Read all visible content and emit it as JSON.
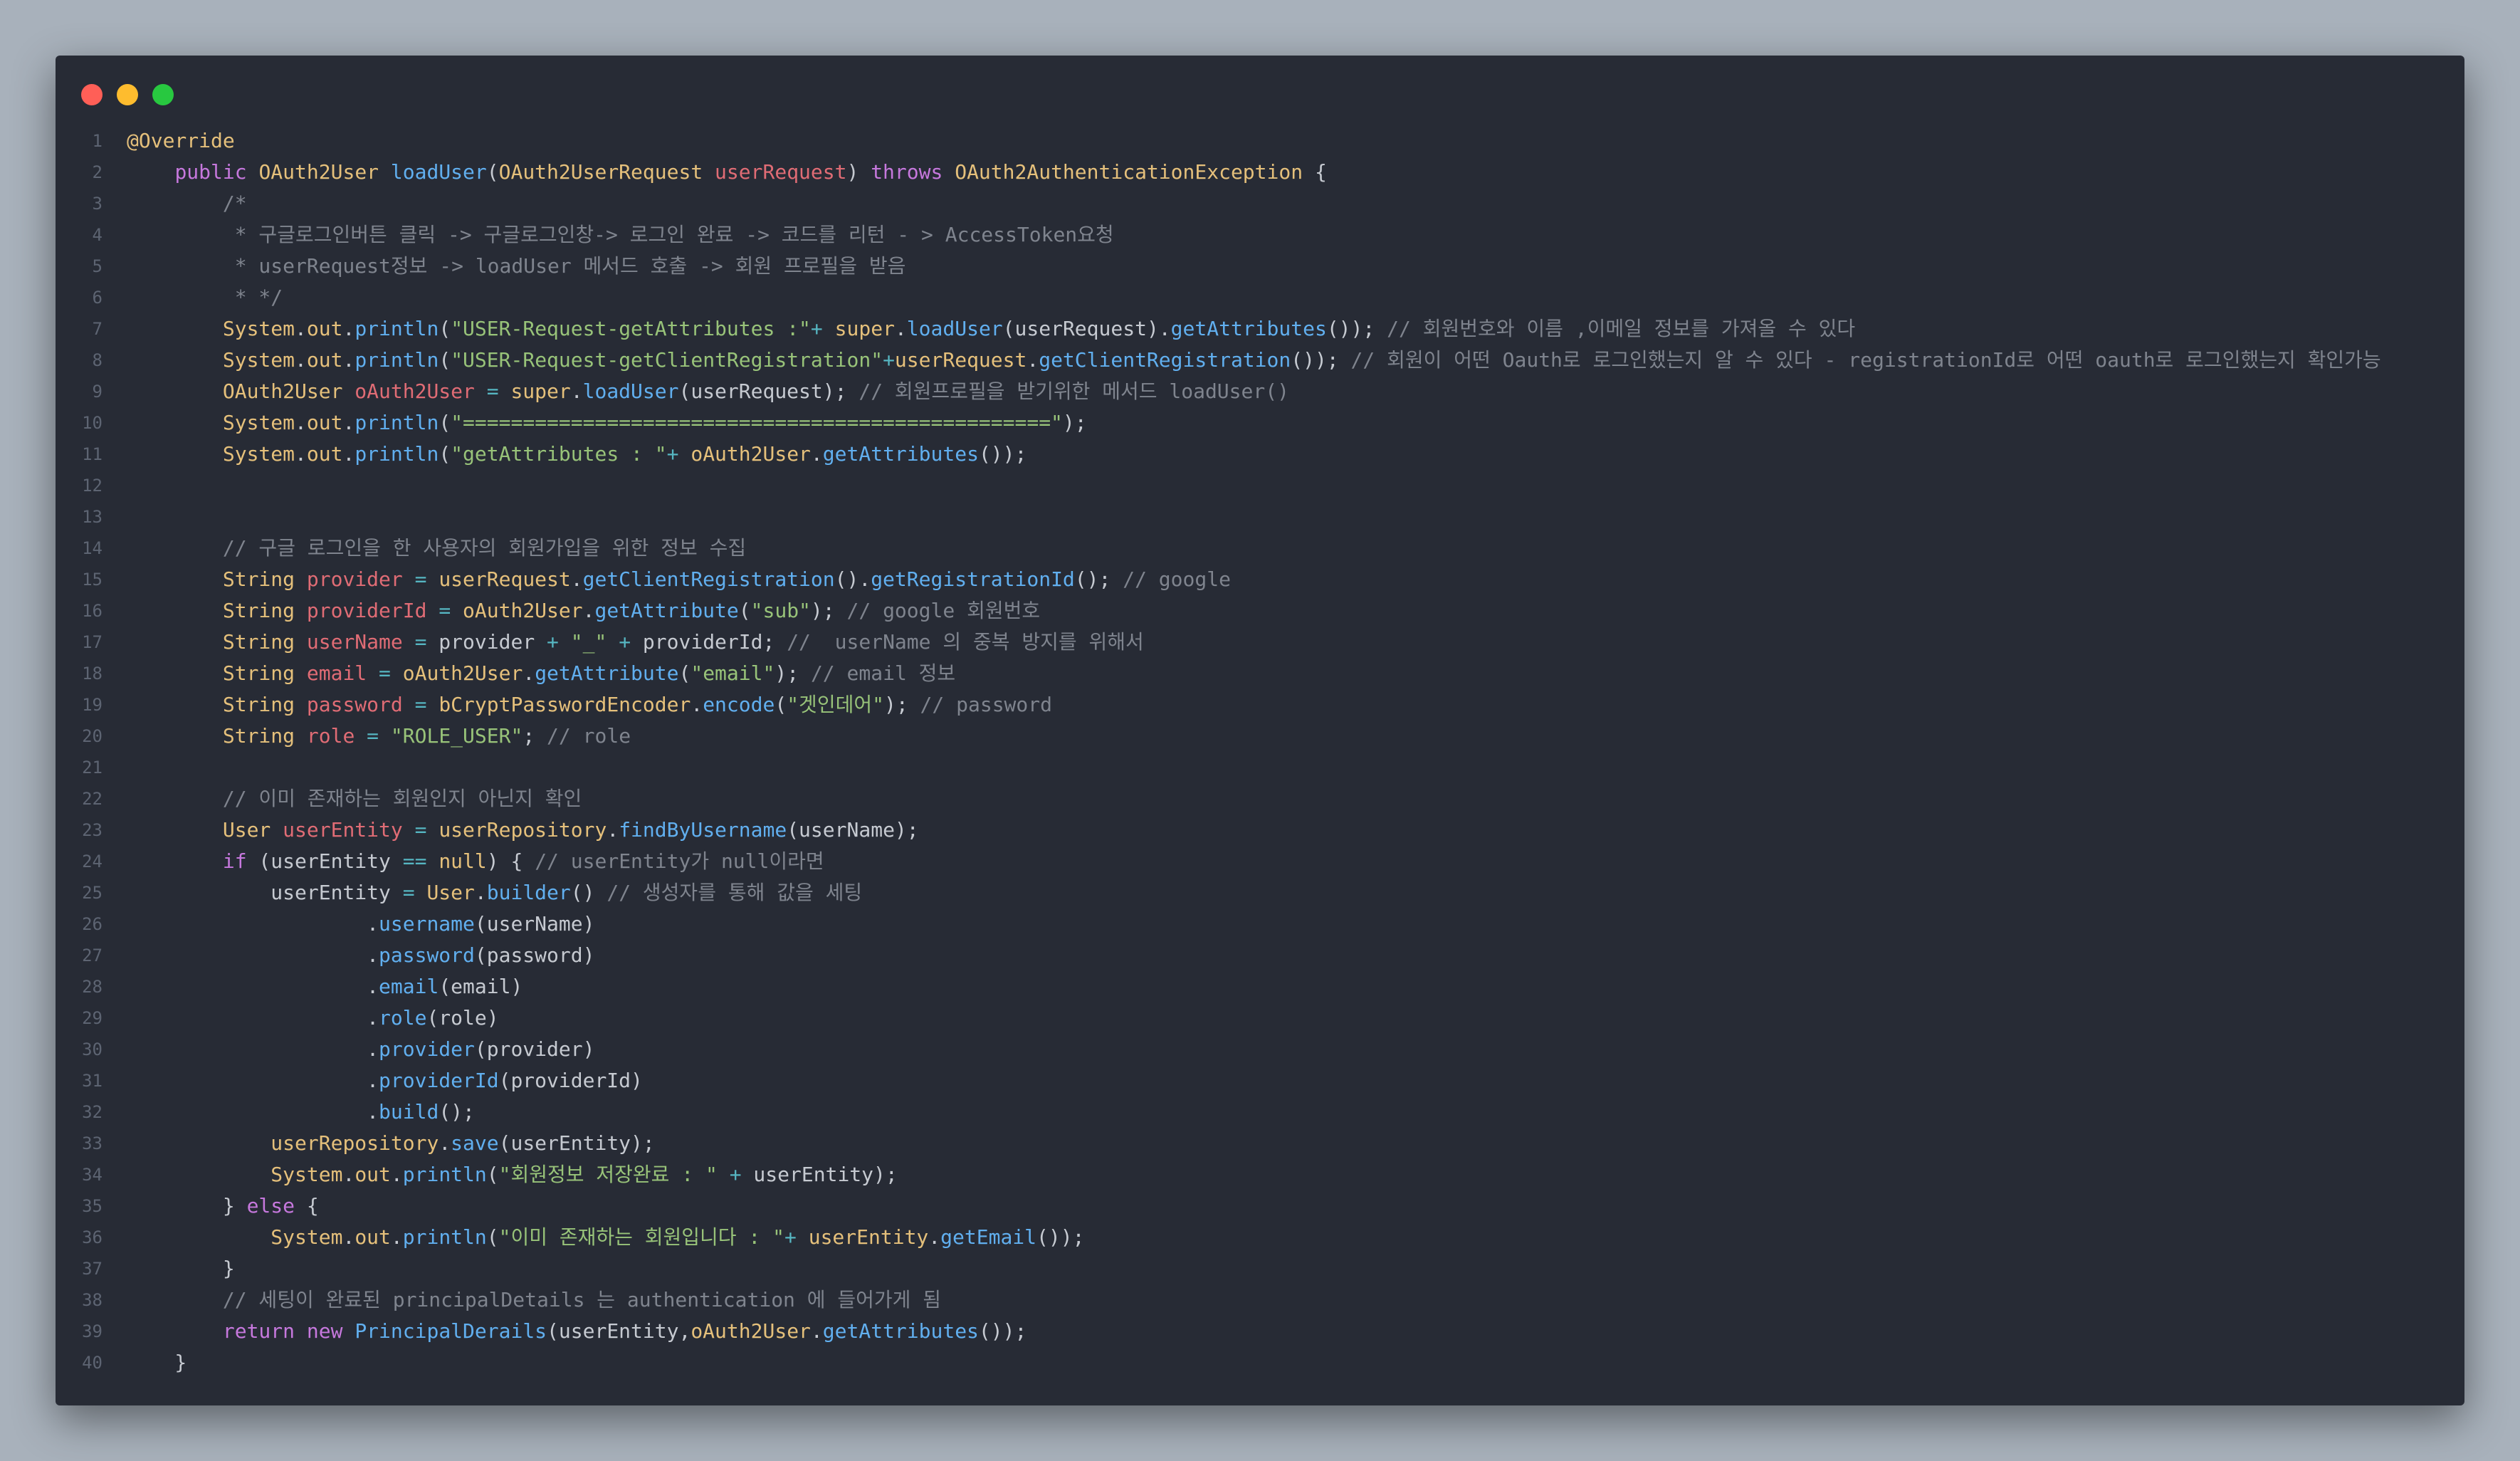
{
  "window": {
    "controls": {
      "close_color": "#ff5f57",
      "minimize_color": "#febc2e",
      "maximize_color": "#28c840"
    }
  },
  "editor": {
    "language": "java",
    "lines": [
      {
        "n": "1",
        "tokens": [
          [
            "a",
            "@Override"
          ]
        ]
      },
      {
        "n": "2",
        "tokens": [
          [
            "p",
            "    "
          ],
          [
            "k",
            "public"
          ],
          [
            "p",
            " "
          ],
          [
            "t",
            "OAuth2User"
          ],
          [
            "p",
            " "
          ],
          [
            "f",
            "loadUser"
          ],
          [
            "p",
            "("
          ],
          [
            "t",
            "OAuth2UserRequest"
          ],
          [
            "p",
            " "
          ],
          [
            "v",
            "userRequest"
          ],
          [
            "p",
            ") "
          ],
          [
            "k",
            "throws"
          ],
          [
            "p",
            " "
          ],
          [
            "t",
            "OAuth2AuthenticationException"
          ],
          [
            "p",
            " {"
          ]
        ]
      },
      {
        "n": "3",
        "tokens": [
          [
            "c",
            "        /*"
          ]
        ]
      },
      {
        "n": "4",
        "tokens": [
          [
            "c",
            "         * 구글로그인버튼 클릭 -> 구글로그인창-> 로그인 완료 -> 코드를 리턴 - > AccessToken요청"
          ]
        ]
      },
      {
        "n": "5",
        "tokens": [
          [
            "c",
            "         * userRequest정보 -> loadUser 메서드 호출 -> 회원 프로필을 받음"
          ]
        ]
      },
      {
        "n": "6",
        "tokens": [
          [
            "c",
            "         * */"
          ]
        ]
      },
      {
        "n": "7",
        "tokens": [
          [
            "p",
            "        "
          ],
          [
            "t",
            "System"
          ],
          [
            "p",
            "."
          ],
          [
            "t",
            "out"
          ],
          [
            "p",
            "."
          ],
          [
            "f",
            "println"
          ],
          [
            "p",
            "("
          ],
          [
            "s",
            "\"USER-Request-getAttributes :\""
          ],
          [
            "o",
            "+"
          ],
          [
            "p",
            " "
          ],
          [
            "t",
            "super"
          ],
          [
            "p",
            "."
          ],
          [
            "f",
            "loadUser"
          ],
          [
            "p",
            "(userRequest)."
          ],
          [
            "f",
            "getAttributes"
          ],
          [
            "p",
            "()); "
          ],
          [
            "c",
            "// 회원번호와 이름 ,이메일 정보를 가져올 수 있다"
          ]
        ]
      },
      {
        "n": "8",
        "tokens": [
          [
            "p",
            "        "
          ],
          [
            "t",
            "System"
          ],
          [
            "p",
            "."
          ],
          [
            "t",
            "out"
          ],
          [
            "p",
            "."
          ],
          [
            "f",
            "println"
          ],
          [
            "p",
            "("
          ],
          [
            "s",
            "\"USER-Request-getClientRegistration\""
          ],
          [
            "o",
            "+"
          ],
          [
            "t",
            "userRequest"
          ],
          [
            "p",
            "."
          ],
          [
            "f",
            "getClientRegistration"
          ],
          [
            "p",
            "()); "
          ],
          [
            "c",
            "// 회원이 어떤 Oauth로 로그인했는지 알 수 있다 - registrationId로 어떤 oauth로 로그인했는지 확인가능"
          ]
        ]
      },
      {
        "n": "9",
        "tokens": [
          [
            "p",
            "        "
          ],
          [
            "t",
            "OAuth2User"
          ],
          [
            "p",
            " "
          ],
          [
            "v",
            "oAuth2User"
          ],
          [
            "p",
            " "
          ],
          [
            "o",
            "="
          ],
          [
            "p",
            " "
          ],
          [
            "t",
            "super"
          ],
          [
            "p",
            "."
          ],
          [
            "f",
            "loadUser"
          ],
          [
            "p",
            "(userRequest); "
          ],
          [
            "c",
            "// 회원프로필을 받기위한 메서드 loadUser()"
          ]
        ]
      },
      {
        "n": "10",
        "tokens": [
          [
            "p",
            "        "
          ],
          [
            "t",
            "System"
          ],
          [
            "p",
            "."
          ],
          [
            "t",
            "out"
          ],
          [
            "p",
            "."
          ],
          [
            "f",
            "println"
          ],
          [
            "p",
            "("
          ],
          [
            "s",
            "\"=================================================\""
          ],
          [
            "p",
            ");"
          ]
        ]
      },
      {
        "n": "11",
        "tokens": [
          [
            "p",
            "        "
          ],
          [
            "t",
            "System"
          ],
          [
            "p",
            "."
          ],
          [
            "t",
            "out"
          ],
          [
            "p",
            "."
          ],
          [
            "f",
            "println"
          ],
          [
            "p",
            "("
          ],
          [
            "s",
            "\"getAttributes : \""
          ],
          [
            "o",
            "+"
          ],
          [
            "p",
            " "
          ],
          [
            "t",
            "oAuth2User"
          ],
          [
            "p",
            "."
          ],
          [
            "f",
            "getAttributes"
          ],
          [
            "p",
            "());"
          ]
        ]
      },
      {
        "n": "12",
        "tokens": []
      },
      {
        "n": "13",
        "tokens": []
      },
      {
        "n": "14",
        "tokens": [
          [
            "c",
            "        // 구글 로그인을 한 사용자의 회원가입을 위한 정보 수집"
          ]
        ]
      },
      {
        "n": "15",
        "tokens": [
          [
            "p",
            "        "
          ],
          [
            "t",
            "String"
          ],
          [
            "p",
            " "
          ],
          [
            "v",
            "provider"
          ],
          [
            "p",
            " "
          ],
          [
            "o",
            "="
          ],
          [
            "p",
            " "
          ],
          [
            "t",
            "userRequest"
          ],
          [
            "p",
            "."
          ],
          [
            "f",
            "getClientRegistration"
          ],
          [
            "p",
            "()."
          ],
          [
            "f",
            "getRegistrationId"
          ],
          [
            "p",
            "(); "
          ],
          [
            "c",
            "// google"
          ]
        ]
      },
      {
        "n": "16",
        "tokens": [
          [
            "p",
            "        "
          ],
          [
            "t",
            "String"
          ],
          [
            "p",
            " "
          ],
          [
            "v",
            "providerId"
          ],
          [
            "p",
            " "
          ],
          [
            "o",
            "="
          ],
          [
            "p",
            " "
          ],
          [
            "t",
            "oAuth2User"
          ],
          [
            "p",
            "."
          ],
          [
            "f",
            "getAttribute"
          ],
          [
            "p",
            "("
          ],
          [
            "s",
            "\"sub\""
          ],
          [
            "p",
            "); "
          ],
          [
            "c",
            "// google 회원번호"
          ]
        ]
      },
      {
        "n": "17",
        "tokens": [
          [
            "p",
            "        "
          ],
          [
            "t",
            "String"
          ],
          [
            "p",
            " "
          ],
          [
            "v",
            "userName"
          ],
          [
            "p",
            " "
          ],
          [
            "o",
            "="
          ],
          [
            "p",
            " provider "
          ],
          [
            "o",
            "+"
          ],
          [
            "p",
            " "
          ],
          [
            "s",
            "\"_\""
          ],
          [
            "p",
            " "
          ],
          [
            "o",
            "+"
          ],
          [
            "p",
            " providerId; "
          ],
          [
            "c",
            "//  userName 의 중복 방지를 위해서"
          ]
        ]
      },
      {
        "n": "18",
        "tokens": [
          [
            "p",
            "        "
          ],
          [
            "t",
            "String"
          ],
          [
            "p",
            " "
          ],
          [
            "v",
            "email"
          ],
          [
            "p",
            " "
          ],
          [
            "o",
            "="
          ],
          [
            "p",
            " "
          ],
          [
            "t",
            "oAuth2User"
          ],
          [
            "p",
            "."
          ],
          [
            "f",
            "getAttribute"
          ],
          [
            "p",
            "("
          ],
          [
            "s",
            "\"email\""
          ],
          [
            "p",
            "); "
          ],
          [
            "c",
            "// email 정보"
          ]
        ]
      },
      {
        "n": "19",
        "tokens": [
          [
            "p",
            "        "
          ],
          [
            "t",
            "String"
          ],
          [
            "p",
            " "
          ],
          [
            "v",
            "password"
          ],
          [
            "p",
            " "
          ],
          [
            "o",
            "="
          ],
          [
            "p",
            " "
          ],
          [
            "t",
            "bCryptPasswordEncoder"
          ],
          [
            "p",
            "."
          ],
          [
            "f",
            "encode"
          ],
          [
            "p",
            "("
          ],
          [
            "s",
            "\"겟인데어\""
          ],
          [
            "p",
            "); "
          ],
          [
            "c",
            "// password"
          ]
        ]
      },
      {
        "n": "20",
        "tokens": [
          [
            "p",
            "        "
          ],
          [
            "t",
            "String"
          ],
          [
            "p",
            " "
          ],
          [
            "v",
            "role"
          ],
          [
            "p",
            " "
          ],
          [
            "o",
            "="
          ],
          [
            "p",
            " "
          ],
          [
            "s",
            "\"ROLE_USER\""
          ],
          [
            "p",
            "; "
          ],
          [
            "c",
            "// role"
          ]
        ]
      },
      {
        "n": "21",
        "tokens": []
      },
      {
        "n": "22",
        "tokens": [
          [
            "c",
            "        // 이미 존재하는 회원인지 아닌지 확인"
          ]
        ]
      },
      {
        "n": "23",
        "tokens": [
          [
            "p",
            "        "
          ],
          [
            "t",
            "User"
          ],
          [
            "p",
            " "
          ],
          [
            "v",
            "userEntity"
          ],
          [
            "p",
            " "
          ],
          [
            "o",
            "="
          ],
          [
            "p",
            " "
          ],
          [
            "t",
            "userRepository"
          ],
          [
            "p",
            "."
          ],
          [
            "f",
            "findByUsername"
          ],
          [
            "p",
            "(userName);"
          ]
        ]
      },
      {
        "n": "24",
        "tokens": [
          [
            "p",
            "        "
          ],
          [
            "k",
            "if"
          ],
          [
            "p",
            " (userEntity "
          ],
          [
            "o",
            "=="
          ],
          [
            "p",
            " "
          ],
          [
            "a",
            "null"
          ],
          [
            "p",
            ") { "
          ],
          [
            "c",
            "// userEntity가 null이라면"
          ]
        ]
      },
      {
        "n": "25",
        "tokens": [
          [
            "p",
            "            userEntity "
          ],
          [
            "o",
            "="
          ],
          [
            "p",
            " "
          ],
          [
            "t",
            "User"
          ],
          [
            "p",
            "."
          ],
          [
            "f",
            "builder"
          ],
          [
            "p",
            "() "
          ],
          [
            "c",
            "// 생성자를 통해 값을 세팅"
          ]
        ]
      },
      {
        "n": "26",
        "tokens": [
          [
            "p",
            "                    ."
          ],
          [
            "f",
            "username"
          ],
          [
            "p",
            "(userName)"
          ]
        ]
      },
      {
        "n": "27",
        "tokens": [
          [
            "p",
            "                    ."
          ],
          [
            "f",
            "password"
          ],
          [
            "p",
            "(password)"
          ]
        ]
      },
      {
        "n": "28",
        "tokens": [
          [
            "p",
            "                    ."
          ],
          [
            "f",
            "email"
          ],
          [
            "p",
            "(email)"
          ]
        ]
      },
      {
        "n": "29",
        "tokens": [
          [
            "p",
            "                    ."
          ],
          [
            "f",
            "role"
          ],
          [
            "p",
            "(role)"
          ]
        ]
      },
      {
        "n": "30",
        "tokens": [
          [
            "p",
            "                    ."
          ],
          [
            "f",
            "provider"
          ],
          [
            "p",
            "(provider)"
          ]
        ]
      },
      {
        "n": "31",
        "tokens": [
          [
            "p",
            "                    ."
          ],
          [
            "f",
            "providerId"
          ],
          [
            "p",
            "(providerId)"
          ]
        ]
      },
      {
        "n": "32",
        "tokens": [
          [
            "p",
            "                    ."
          ],
          [
            "f",
            "build"
          ],
          [
            "p",
            "();"
          ]
        ]
      },
      {
        "n": "33",
        "tokens": [
          [
            "p",
            "            "
          ],
          [
            "t",
            "userRepository"
          ],
          [
            "p",
            "."
          ],
          [
            "f",
            "save"
          ],
          [
            "p",
            "(userEntity);"
          ]
        ]
      },
      {
        "n": "34",
        "tokens": [
          [
            "p",
            "            "
          ],
          [
            "t",
            "System"
          ],
          [
            "p",
            "."
          ],
          [
            "t",
            "out"
          ],
          [
            "p",
            "."
          ],
          [
            "f",
            "println"
          ],
          [
            "p",
            "("
          ],
          [
            "s",
            "\"회원정보 저장완료 : \""
          ],
          [
            "p",
            " "
          ],
          [
            "o",
            "+"
          ],
          [
            "p",
            " userEntity);"
          ]
        ]
      },
      {
        "n": "35",
        "tokens": [
          [
            "p",
            "        } "
          ],
          [
            "k",
            "else"
          ],
          [
            "p",
            " {"
          ]
        ]
      },
      {
        "n": "36",
        "tokens": [
          [
            "p",
            "            "
          ],
          [
            "t",
            "System"
          ],
          [
            "p",
            "."
          ],
          [
            "t",
            "out"
          ],
          [
            "p",
            "."
          ],
          [
            "f",
            "println"
          ],
          [
            "p",
            "("
          ],
          [
            "s",
            "\"이미 존재하는 회원입니다 : \""
          ],
          [
            "o",
            "+"
          ],
          [
            "p",
            " "
          ],
          [
            "t",
            "userEntity"
          ],
          [
            "p",
            "."
          ],
          [
            "f",
            "getEmail"
          ],
          [
            "p",
            "());"
          ]
        ]
      },
      {
        "n": "37",
        "tokens": [
          [
            "p",
            "        }"
          ]
        ]
      },
      {
        "n": "38",
        "tokens": [
          [
            "c",
            "        // 세팅이 완료된 principalDetails 는 authentication 에 들어가게 됨"
          ]
        ]
      },
      {
        "n": "39",
        "tokens": [
          [
            "p",
            "        "
          ],
          [
            "k",
            "return"
          ],
          [
            "p",
            " "
          ],
          [
            "k",
            "new"
          ],
          [
            "p",
            " "
          ],
          [
            "f",
            "PrincipalDerails"
          ],
          [
            "p",
            "(userEntity,"
          ],
          [
            "t",
            "oAuth2User"
          ],
          [
            "p",
            "."
          ],
          [
            "f",
            "getAttributes"
          ],
          [
            "p",
            "());"
          ]
        ]
      },
      {
        "n": "40",
        "tokens": [
          [
            "p",
            "    }"
          ]
        ]
      }
    ]
  }
}
